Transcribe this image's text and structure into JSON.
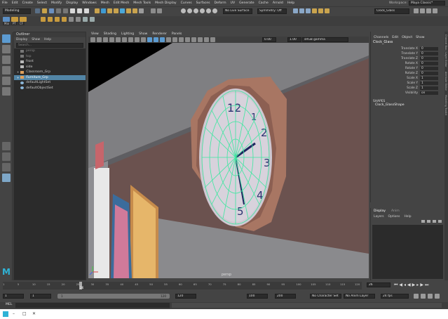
{
  "menubar": {
    "items": [
      "File",
      "Edit",
      "Create",
      "Select",
      "Modify",
      "Display",
      "Windows",
      "Mesh",
      "Edit Mesh",
      "Mesh Tools",
      "Mesh Display",
      "Curves",
      "Surfaces",
      "Deform",
      "UV",
      "Generate",
      "Cache",
      "Arnold",
      "Help"
    ],
    "workspace_label": "Workspace:",
    "workspace_value": "Maya Classic*"
  },
  "status": {
    "mode": "Modeling",
    "live_surface": "No Live Surface",
    "symmetry": "Symmetry: Off",
    "selection_field": "Clock_Glass"
  },
  "shelf": {
    "tabs": [
      "Mai",
      "PT",
      "CF"
    ]
  },
  "outliner": {
    "title": "Outliner",
    "menu": [
      "Display",
      "Show",
      "Help"
    ],
    "search_placeholder": "Search...",
    "items": [
      {
        "label": "persp",
        "style": "dim"
      },
      {
        "label": "top",
        "style": "dim"
      },
      {
        "label": "front",
        "style": "normal"
      },
      {
        "label": "side",
        "style": "normal"
      },
      {
        "label": "Classroom_Grp",
        "style": "normal"
      },
      {
        "label": "Furniture_Grp",
        "style": "selected"
      },
      {
        "label": "defaultLightSet",
        "style": "normal"
      },
      {
        "label": "defaultObjectSet",
        "style": "normal"
      }
    ]
  },
  "viewport": {
    "menu": [
      "View",
      "Shading",
      "Lighting",
      "Show",
      "Renderer",
      "Panels"
    ],
    "field_a": "0.00",
    "field_b": "1.00",
    "colorspace": "sRGB gamma",
    "camera_label": "persp",
    "clock_numbers": [
      "12",
      "1",
      "2",
      "3",
      "4",
      "5"
    ]
  },
  "channelbox": {
    "menu": [
      "Channels",
      "Edit",
      "Object",
      "Show"
    ],
    "object_name": "Clock_Glass",
    "attributes": [
      {
        "name": "Translate X",
        "value": "0"
      },
      {
        "name": "Translate Y",
        "value": "0"
      },
      {
        "name": "Translate Z",
        "value": "0"
      },
      {
        "name": "Rotate X",
        "value": "0"
      },
      {
        "name": "Rotate Y",
        "value": "0"
      },
      {
        "name": "Rotate Z",
        "value": "0"
      },
      {
        "name": "Scale X",
        "value": "1"
      },
      {
        "name": "Scale Y",
        "value": "1"
      },
      {
        "name": "Scale Z",
        "value": "1"
      },
      {
        "name": "Visibility",
        "value": "on"
      }
    ],
    "shapes_header": "SHAPES",
    "shape_name": "Clock_GlassShape"
  },
  "layers": {
    "tabs": [
      "Display",
      "Anim"
    ],
    "menu": [
      "Layers",
      "Options",
      "Help"
    ]
  },
  "sidetabs": [
    "Channel Box / Layer Editor",
    "Attribute Editor",
    "Modelling Toolkit"
  ],
  "timeslider": {
    "ticks": [
      "1",
      "5",
      "10",
      "15",
      "20",
      "25",
      "30",
      "35",
      "40",
      "45",
      "50",
      "55",
      "60",
      "65",
      "70",
      "75",
      "80",
      "85",
      "90",
      "95",
      "100",
      "105",
      "110",
      "115",
      "120"
    ],
    "current_frame": "26",
    "current_field": "26"
  },
  "range": {
    "start": "1",
    "start2": "1",
    "range_mid": "1",
    "range_end_label": "120",
    "end": "120",
    "end2": "100",
    "end3": "200",
    "character_set": "No Character Set",
    "anim_layer": "No Anim Layer",
    "fps": "24 fps"
  },
  "cmdline": {
    "label": "MEL"
  },
  "colors": {
    "wireframe": "#3de8a0",
    "selection": "#5285a6",
    "accent_cyan": "#2fb3d6"
  }
}
